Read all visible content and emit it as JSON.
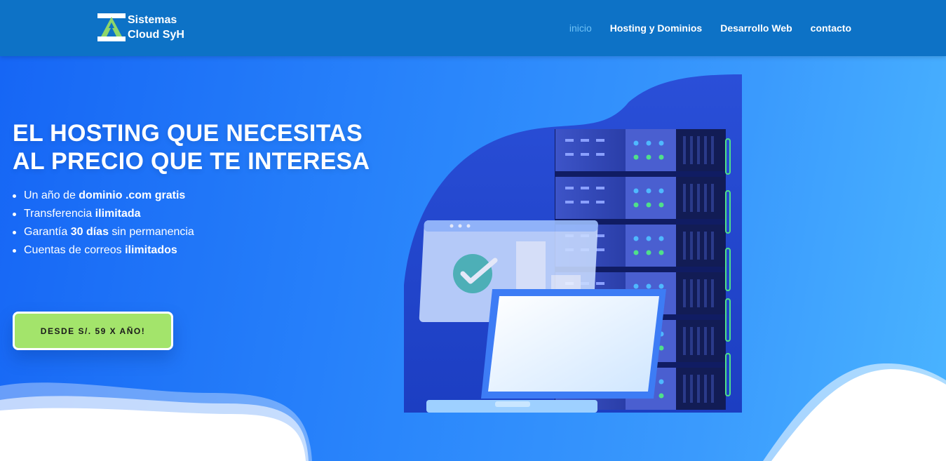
{
  "header": {
    "logo_line1": "Sistemas",
    "logo_line2": "Cloud SyH",
    "nav": [
      {
        "label": "inicio",
        "active": true
      },
      {
        "label": "Hosting y Dominios",
        "active": false
      },
      {
        "label": "Desarrollo Web",
        "active": false
      },
      {
        "label": "contacto",
        "active": false
      }
    ]
  },
  "hero": {
    "headline_line1": "EL HOSTING QUE NECESITAS",
    "headline_line2": "AL PRECIO QUE TE INTERESA",
    "features": [
      {
        "pre": "Un año de ",
        "bold": "dominio .com gratis",
        "post": ""
      },
      {
        "pre": "Transferencia ",
        "bold": "ilimitada",
        "post": ""
      },
      {
        "pre": "Garantía ",
        "bold": "30 días",
        "post": " sin permanencia"
      },
      {
        "pre": "Cuentas de correos ",
        "bold": "ilimitados",
        "post": ""
      }
    ],
    "cta_label": "DESDE S/. 59 X AÑO!"
  },
  "colors": {
    "header_bg": "#0d72c6",
    "nav_active": "#6ec1f6",
    "cta_bg": "#a3e46b",
    "hero_gradient_start": "#1666f5",
    "hero_gradient_end": "#4ab4ff"
  },
  "icons": {
    "logo": "triangle-logo-icon",
    "illustration": "server-rack-laptop-illustration"
  }
}
